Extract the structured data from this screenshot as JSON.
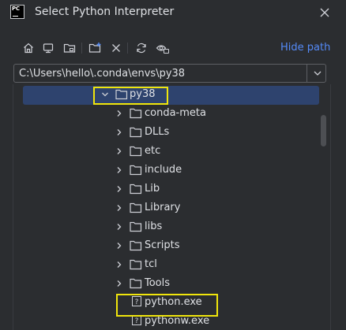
{
  "window": {
    "title": "Select Python Interpreter",
    "logo_text": "PC"
  },
  "toolbar": {
    "icons": [
      "home-icon",
      "desktop-icon",
      "project-folder-icon",
      "new-folder-icon",
      "delete-icon",
      "refresh-icon",
      "hidden-files-icon"
    ],
    "hide_path_label": "Hide path"
  },
  "path_field": {
    "value": "C:\\Users\\hello\\.conda\\envs\\py38"
  },
  "tree": {
    "selected_folder": "py38",
    "children": [
      {
        "label": "conda-meta",
        "type": "folder"
      },
      {
        "label": "DLLs",
        "type": "folder"
      },
      {
        "label": "etc",
        "type": "folder"
      },
      {
        "label": "include",
        "type": "folder"
      },
      {
        "label": "Lib",
        "type": "folder"
      },
      {
        "label": "Library",
        "type": "folder"
      },
      {
        "label": "libs",
        "type": "folder"
      },
      {
        "label": "Scripts",
        "type": "folder"
      },
      {
        "label": "tcl",
        "type": "folder"
      },
      {
        "label": "Tools",
        "type": "folder"
      },
      {
        "label": "python.exe",
        "type": "file"
      },
      {
        "label": "pythonw.exe",
        "type": "file"
      }
    ]
  },
  "colors": {
    "background": "#2b2d30",
    "selection": "#2e436e",
    "link": "#548af7",
    "highlight_box": "#f0e50c"
  }
}
